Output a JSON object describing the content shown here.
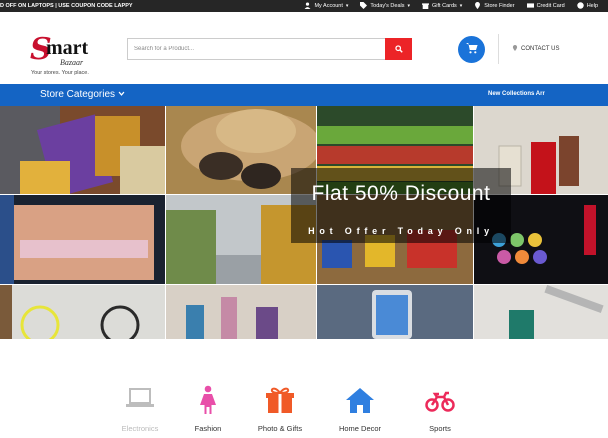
{
  "topbar": {
    "promo": "D OFF ON LAPTOPS | USE COUPON CODE LAPPY",
    "links": [
      {
        "label": "My Account",
        "icon": "user-icon",
        "dropdown": true
      },
      {
        "label": "Today's Deals",
        "icon": "tag-icon",
        "dropdown": true
      },
      {
        "label": "Gift Cards",
        "icon": "gift-icon",
        "dropdown": true
      },
      {
        "label": "Store Finder",
        "icon": "map-marker-icon",
        "dropdown": false
      },
      {
        "label": "Credit Card",
        "icon": "credit-card-icon",
        "dropdown": false
      },
      {
        "label": "Help",
        "icon": "help-icon",
        "dropdown": false
      }
    ]
  },
  "header": {
    "logo": {
      "initial": "S",
      "word": "mart",
      "sub": "Bazaar",
      "tagline": "Your stores. Your place."
    },
    "search": {
      "placeholder": "Search for a Product..."
    },
    "contact_label": "CONTACT US"
  },
  "catbar": {
    "stores_label": "Store Categories",
    "new_collections": "New Collections Arr"
  },
  "banner": {
    "headline": "Flat 50% Discount",
    "subline": "Hot Offer Today Only"
  },
  "categories": [
    {
      "label": "Electronics",
      "icon": "laptop-icon",
      "color": "#bdbdbd"
    },
    {
      "label": "Fashion",
      "icon": "woman-icon",
      "color": "#e84fa9"
    },
    {
      "label": "Photo & Gifts",
      "icon": "gift-icon",
      "color": "#f05a28"
    },
    {
      "label": "Home Decor",
      "icon": "home-icon",
      "color": "#2f7fe0"
    },
    {
      "label": "Sports",
      "icon": "motorcycle-icon",
      "color": "#ec2a5a"
    }
  ],
  "colors": {
    "brand_blue": "#1464c4",
    "search_red": "#ec2427",
    "cart_blue": "#1a73d9",
    "logo_red": "#c8102e"
  }
}
